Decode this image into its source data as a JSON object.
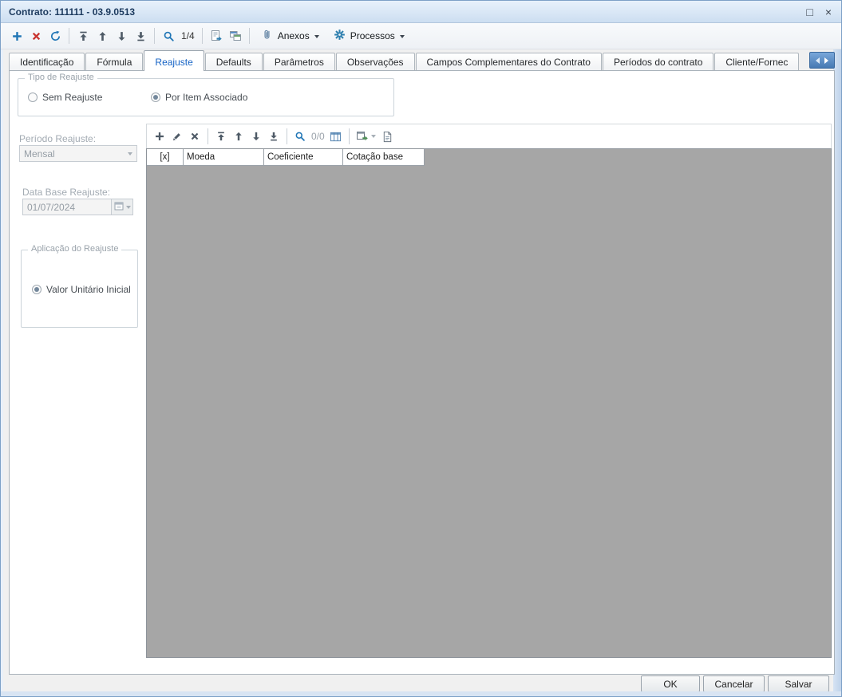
{
  "colors": {
    "accent_blue": "#2176b6",
    "active_tab_text": "#1563c5",
    "danger_red": "#c8342f",
    "grid_body_gray": "#a6a6a6",
    "titlebar_text": "#1c3a5e",
    "disabled_text": "#a3abb3"
  },
  "window": {
    "title": "Contrato: 111111 - 03.9.0513",
    "maximize_glyph": "□",
    "close_glyph": "×"
  },
  "toolbar": {
    "record_counter": "1/4",
    "anexos": "Anexos",
    "processos": "Processos"
  },
  "icons": {
    "add": "+",
    "delete": "✖",
    "refresh": "⟳",
    "first": "⤒",
    "up": "↑",
    "down": "↓",
    "last": "⤓",
    "search": "🔍",
    "edit": "✎",
    "attachment": "📎",
    "gear": "⚙",
    "calendar": "📅",
    "dropdown": "▾",
    "tab_scroll_left": "◀",
    "tab_scroll_right": "▶"
  },
  "tabs": [
    "Identificação",
    "Fórmula",
    "Reajuste",
    "Defaults",
    "Parâmetros",
    "Observações",
    "Campos Complementares do Contrato",
    "Períodos do contrato",
    "Cliente/Fornec"
  ],
  "form": {
    "tipo_group_title": "Tipo de Reajuste",
    "radio_sem": "Sem Reajuste",
    "radio_por_item": "Por Item Associado",
    "periodo_label": "Período Reajuste:",
    "periodo_value": "Mensal",
    "data_base_label": "Data Base Reajuste:",
    "data_base_value": "01/07/2024",
    "aplicacao_group_title": "Aplicação do Reajuste",
    "radio_valor_unitario": "Valor Unitário Inicial"
  },
  "grid": {
    "counter": "0/0",
    "columns": [
      "[x]",
      "Moeda",
      "Coeficiente",
      "Cotação base"
    ],
    "rows": []
  },
  "footer": {
    "ok": "OK",
    "cancel": "Cancelar",
    "save": "Salvar"
  }
}
